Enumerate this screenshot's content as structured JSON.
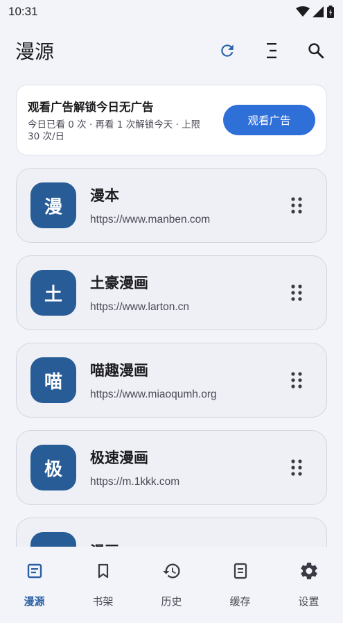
{
  "status_bar": {
    "time": "10:31"
  },
  "app_bar": {
    "title": "漫源",
    "refresh_icon": "refresh-icon",
    "sort_icon": "sort-icon",
    "search_icon": "search-icon"
  },
  "ad_card": {
    "title": "观看广告解锁今日无广告",
    "description": "今日已看 0 次 · 再看 1 次解锁今天 · 上限 30 次/日",
    "button_label": "观看广告"
  },
  "sources": [
    {
      "avatar": "漫",
      "name": "漫本",
      "url": "https://www.manben.com"
    },
    {
      "avatar": "土",
      "name": "土豪漫画",
      "url": "https://www.larton.cn"
    },
    {
      "avatar": "喵",
      "name": "喵趣漫画",
      "url": "https://www.miaoqumh.org"
    },
    {
      "avatar": "极",
      "name": "极速漫画",
      "url": "https://m.1kkk.com"
    },
    {
      "avatar": "漫",
      "name": "漫画manga",
      "url": ""
    }
  ],
  "bottom_nav": [
    {
      "label": "漫源",
      "icon": "source-icon",
      "active": true
    },
    {
      "label": "书架",
      "icon": "bookmark-icon",
      "active": false
    },
    {
      "label": "历史",
      "icon": "history-icon",
      "active": false
    },
    {
      "label": "缓存",
      "icon": "download-icon",
      "active": false
    },
    {
      "label": "设置",
      "icon": "gear-icon",
      "active": false
    }
  ],
  "colors": {
    "accent": "#2f6fd8",
    "avatar_bg": "#285c96",
    "active_nav": "#2a5fa3",
    "background": "#f2f4f9"
  }
}
